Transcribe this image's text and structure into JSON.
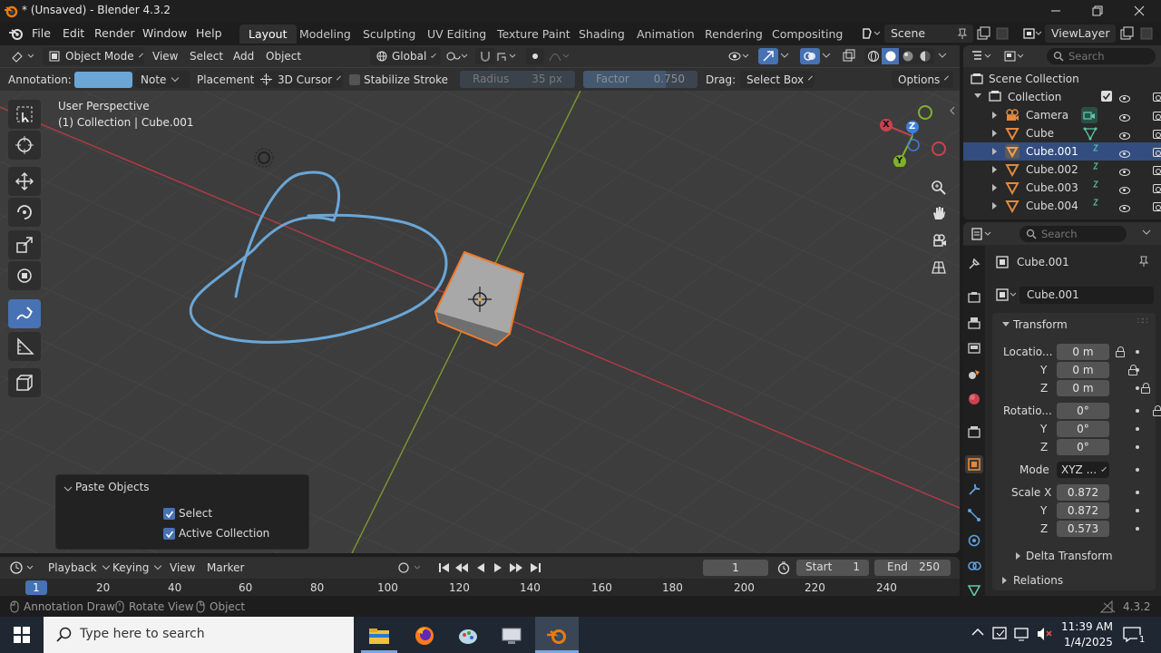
{
  "window": {
    "title": "* (Unsaved) - Blender 4.3.2"
  },
  "menu": {
    "file": "File",
    "edit": "Edit",
    "render": "Render",
    "window": "Window",
    "help": "Help"
  },
  "workspaces": [
    "Layout",
    "Modeling",
    "Sculpting",
    "UV Editing",
    "Texture Paint",
    "Shading",
    "Animation",
    "Rendering",
    "Compositing"
  ],
  "scene": {
    "name": "Scene",
    "view_layer": "ViewLayer"
  },
  "header": {
    "mode": "Object Mode",
    "view": "View",
    "select": "Select",
    "add": "Add",
    "object": "Object",
    "orientation": "Global"
  },
  "toolsettings": {
    "annotation_label": "Annotation:",
    "annotation_color": "#6aa6d6",
    "note": "Note",
    "placement_label": "Placement:",
    "placement": "3D Cursor",
    "stabilize": "Stabilize Stroke",
    "radius_label": "Radius",
    "radius_value": "35 px",
    "factor_label": "Factor",
    "factor_value": "0.750",
    "drag_label": "Drag:",
    "drag_value": "Select Box",
    "options": "Options"
  },
  "viewport": {
    "perspective": "User Perspective",
    "context": "(1) Collection | Cube.001",
    "gizmo": {
      "x": "X",
      "y": "Y",
      "z": "Z"
    }
  },
  "paste_panel": {
    "title": "Paste Objects",
    "select": "Select",
    "active_collection": "Active Collection"
  },
  "outliner": {
    "search_placeholder": "Search",
    "scene_collection": "Scene Collection",
    "collection": "Collection",
    "items": [
      "Camera",
      "Cube",
      "Cube.001",
      "Cube.002",
      "Cube.003",
      "Cube.004"
    ]
  },
  "properties": {
    "search_placeholder": "Search",
    "object_name": "Cube.001",
    "data_name": "Cube.001",
    "transform": "Transform",
    "location": {
      "label": "Locatio...",
      "x": "0 m",
      "y_label": "Y",
      "y": "0 m",
      "z_label": "Z",
      "z": "0 m"
    },
    "rotation": {
      "label": "Rotatio...",
      "x": "0°",
      "y_label": "Y",
      "y": "0°",
      "z_label": "Z",
      "z": "0°"
    },
    "mode_label": "Mode",
    "mode_value": "XYZ ...",
    "scale": {
      "label": "Scale X",
      "x": "0.872",
      "y_label": "Y",
      "y": "0.872",
      "z_label": "Z",
      "z": "0.573"
    },
    "delta": "Delta Transform",
    "relations": "Relations"
  },
  "timeline": {
    "playback": "Playback",
    "keying": "Keying",
    "view": "View",
    "marker": "Marker",
    "current_frame": "1",
    "start_label": "Start",
    "start": "1",
    "end_label": "End",
    "end": "250",
    "ruler": [
      "1",
      "20",
      "40",
      "60",
      "80",
      "100",
      "120",
      "140",
      "160",
      "180",
      "200",
      "220",
      "240"
    ]
  },
  "statusbar": {
    "annotation_draw": "Annotation Draw",
    "rotate_view": "Rotate View",
    "object": "Object",
    "version": "4.3.2"
  },
  "taskbar": {
    "search_placeholder": "Type here to search",
    "time": "11:39 AM",
    "date": "1/4/2025",
    "notifications": "1"
  }
}
